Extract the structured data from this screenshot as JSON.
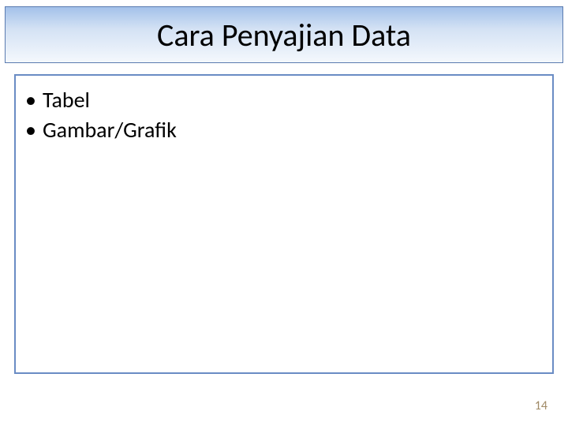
{
  "title": "Cara Penyajian Data",
  "bullets": {
    "item0": "Tabel",
    "item1": "Gambar/Grafik"
  },
  "page_number": "14"
}
